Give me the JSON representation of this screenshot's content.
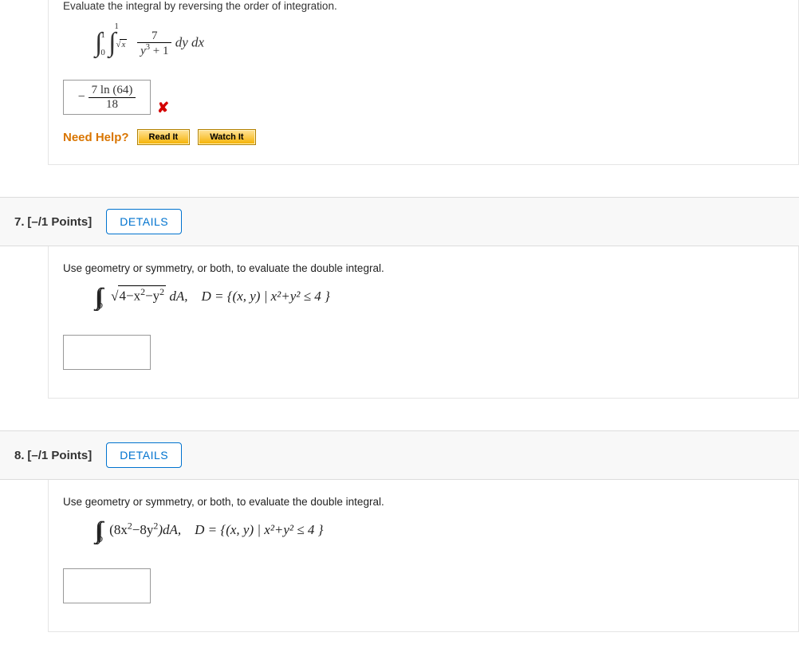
{
  "q6": {
    "prompt": "Evaluate the integral by reversing the order of integration.",
    "integral_tail": " dy dx",
    "outer_lower": "0",
    "outer_upper": "1",
    "inner_upper": "1",
    "inner_lower_surd": "x",
    "frac_num": "7",
    "frac_den_left": "y",
    "frac_den_exp": "3",
    "frac_den_right": " + 1",
    "answer_num": "7 ln (64)",
    "answer_den": "18",
    "answer_prefix": "−",
    "xmark": "✘",
    "need_help": "Need Help?",
    "read_it": "Read It",
    "watch_it": "Watch It"
  },
  "q7": {
    "number": "7.",
    "points": "[–/1 Points]",
    "details": "DETAILS",
    "prompt": "Use geometry or symmetry, or both, to evaluate the double integral.",
    "surd_inner_a": "4−x",
    "surd_inner_b": "−y",
    "exp2": "2",
    "dA": " dA,",
    "region": "D = {(x, y) | x²+y² ≤ 4 }"
  },
  "q8": {
    "number": "8.",
    "points": "[–/1 Points]",
    "details": "DETAILS",
    "prompt": "Use geometry or symmetry, or both, to evaluate the double integral.",
    "integrand_a": "(8x",
    "integrand_b": "−8y",
    "integrand_c": ")dA,",
    "exp2": "2",
    "region": "D = {(x, y) | x²+y² ≤ 4 }"
  }
}
